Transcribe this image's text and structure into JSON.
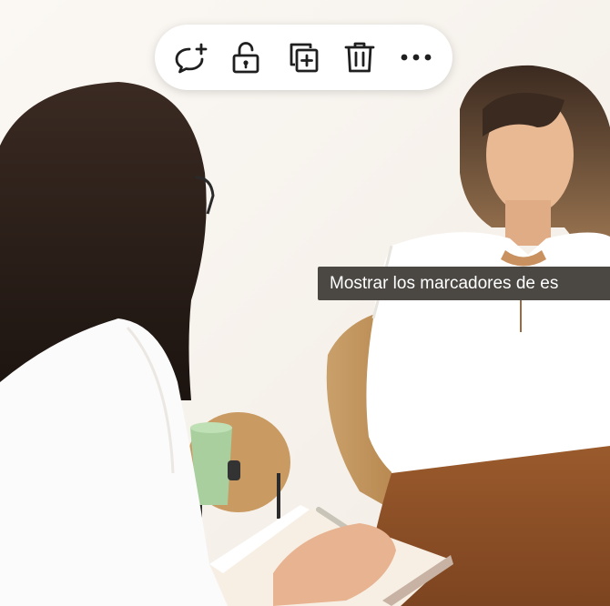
{
  "toolbar": {
    "buttons": [
      {
        "name": "add-comment",
        "icon": "comment-plus-icon"
      },
      {
        "name": "unlock",
        "icon": "unlock-icon"
      },
      {
        "name": "duplicate",
        "icon": "duplicate-icon"
      },
      {
        "name": "delete",
        "icon": "trash-icon"
      },
      {
        "name": "more",
        "icon": "more-horizontal-icon"
      }
    ]
  },
  "tooltip": {
    "text": "Mostrar los marcadores de es"
  },
  "colors": {
    "toolbar_bg": "#ffffff",
    "icon_color": "#1f1f1f",
    "tooltip_bg": "#4b4844",
    "tooltip_text": "#ffffff"
  }
}
